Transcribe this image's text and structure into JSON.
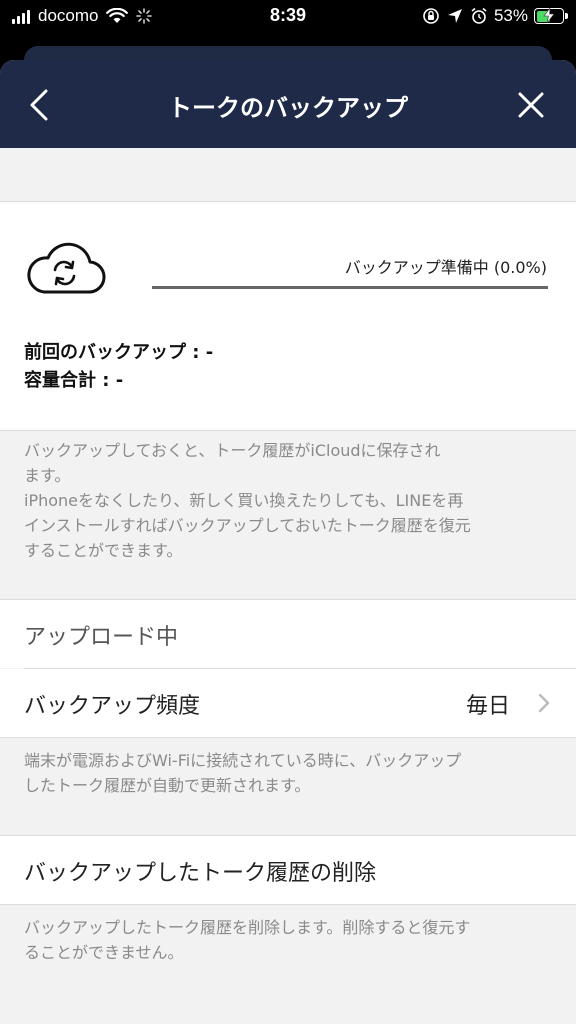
{
  "status_bar": {
    "carrier": "docomo",
    "time": "8:39",
    "battery_percent": "53%",
    "battery_level": 0.53,
    "icons": [
      "signal-icon",
      "wifi-icon",
      "activity-spinner-icon",
      "orientation-lock-icon",
      "location-icon",
      "alarm-icon",
      "battery-icon"
    ]
  },
  "nav": {
    "title": "トークのバックアップ",
    "back_icon": "back-chevron-icon",
    "close_icon": "close-icon"
  },
  "backup": {
    "cloud_icon": "cloud-sync-icon",
    "progress_label": "バックアップ準備中 (0.0%)",
    "progress_value": 0.0,
    "last_backup": "前回のバックアップ : -",
    "total_size": "容量合計 : -"
  },
  "description_1": {
    "line1": "バックアップしておくと、トーク履歴がiCloudに保存され",
    "line2": "ます。",
    "line3": "iPhoneをなくしたり、新しく買い換えたりしても、LINEを再",
    "line4": "インストールすればバックアップしておいたトーク履歴を復元",
    "line5": "することができます。"
  },
  "upload_status": "アップロード中",
  "frequency": {
    "label": "バックアップ頻度",
    "value": "毎日"
  },
  "description_2": {
    "line1": "端末が電源およびWi-Fiに接続されている時に、バックアップ",
    "line2": "したトーク履歴が自動で更新されます。"
  },
  "delete": {
    "label": "バックアップしたトーク履歴の削除"
  },
  "description_3": {
    "line1": "バックアップしたトーク履歴を削除します。削除すると復元す",
    "line2": "ることができません。"
  },
  "colors": {
    "nav_background": "#1e2a47",
    "progress_fill": "#666666",
    "battery_fill": "#4cd964"
  }
}
